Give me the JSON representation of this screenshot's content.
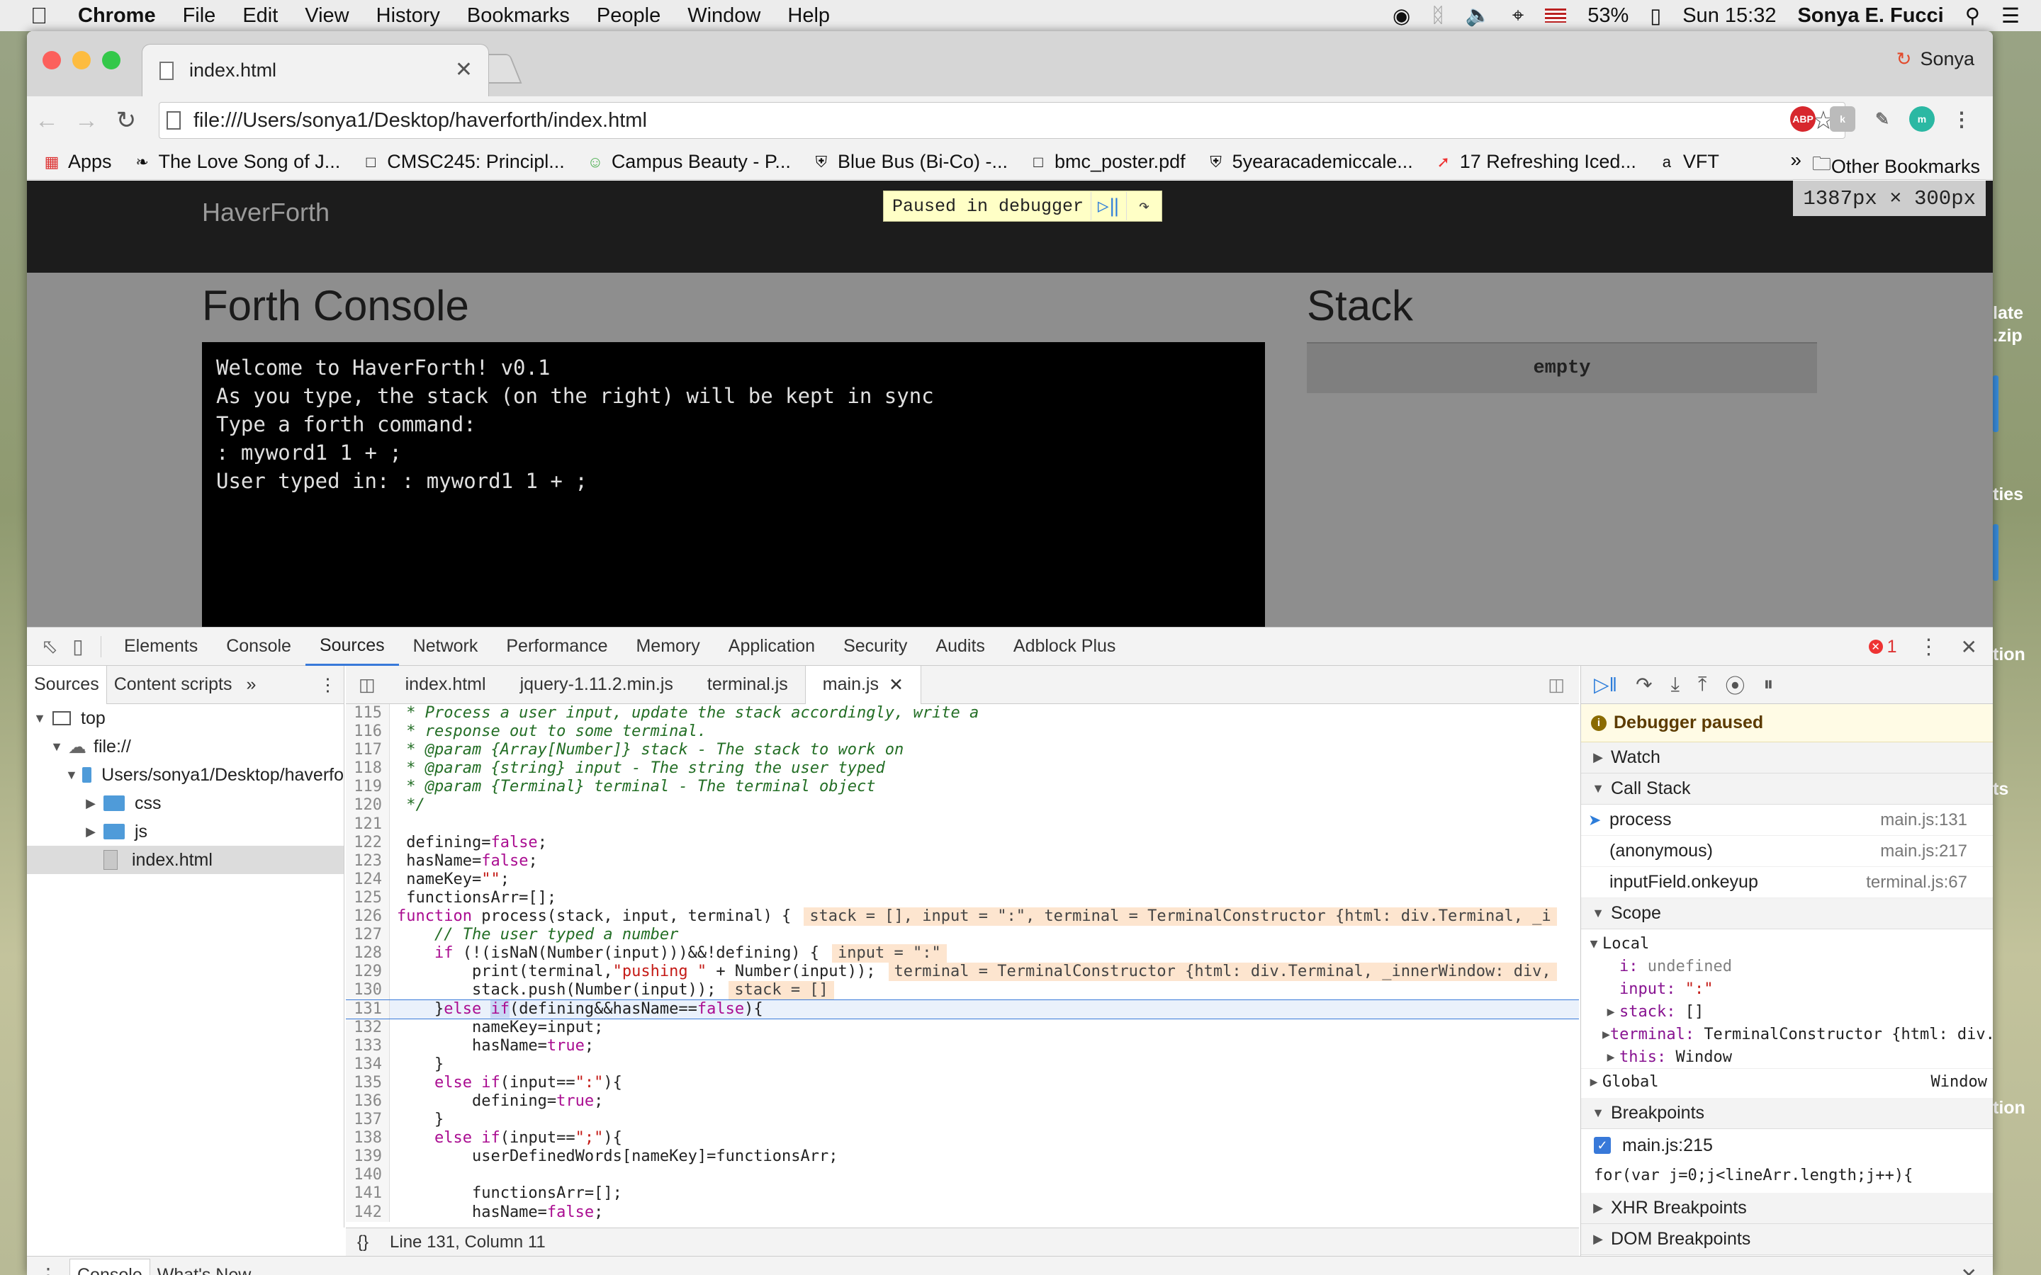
{
  "menubar": {
    "app": "Chrome",
    "items": [
      "File",
      "Edit",
      "View",
      "History",
      "Bookmarks",
      "People",
      "Window",
      "Help"
    ],
    "battery": "53%",
    "clock": "Sun 15:32",
    "user": "Sonya E. Fucci"
  },
  "browser": {
    "tab_title": "index.html",
    "profile_name": "Sonya",
    "url": "file:///Users/sonya1/Desktop/haverforth/index.html",
    "bookmarks": [
      "Apps",
      "The Love Song of J...",
      "CMSC245: Principl...",
      "Campus Beauty - P...",
      "Blue Bus (Bi-Co) -...",
      "bmc_poster.pdf",
      "5yearacademiccale...",
      "17 Refreshing Iced...",
      "VFT"
    ],
    "other_bookmarks": "Other Bookmarks"
  },
  "page": {
    "brand": "HaverForth",
    "paused_label": "Paused in debugger",
    "viewport_dims": "1387px × 300px",
    "console_title": "Forth Console",
    "stack_title": "Stack",
    "terminal_lines": [
      "Welcome to HaverForth! v0.1",
      "As you type, the stack (on the right) will be kept in sync",
      "Type a forth command:",
      ": myword1 1 + ;",
      "User typed in: : myword1 1 + ;"
    ],
    "stack_value": "empty"
  },
  "devtools": {
    "tabs": [
      "Elements",
      "Console",
      "Sources",
      "Network",
      "Performance",
      "Memory",
      "Application",
      "Security",
      "Audits",
      "Adblock Plus"
    ],
    "active_tab": "Sources",
    "error_count": "1",
    "navigator_tabs": [
      "Sources",
      "Content scripts"
    ],
    "tree": {
      "top": "top",
      "origin": "file://",
      "folder": "Users/sonya1/Desktop/haverfo",
      "css": "css",
      "js": "js",
      "file": "index.html"
    },
    "editor_tabs": [
      "index.html",
      "jquery-1.11.2.min.js",
      "terminal.js",
      "main.js"
    ],
    "status": "Line 131, Column 11",
    "debugger_paused": "Debugger paused",
    "sections": {
      "watch": "Watch",
      "call_stack": "Call Stack",
      "scope": "Scope",
      "breakpoints": "Breakpoints",
      "xhr": "XHR Breakpoints",
      "dom": "DOM Breakpoints"
    },
    "call_stack": [
      {
        "fn": "process",
        "loc": "main.js:131"
      },
      {
        "fn": "(anonymous)",
        "loc": "main.js:217"
      },
      {
        "fn": "inputField.onkeyup",
        "loc": "terminal.js:67"
      }
    ],
    "scope": {
      "local_label": "Local",
      "i_key": "i:",
      "i_val": "undefined",
      "input_key": "input:",
      "input_val": "\":\"",
      "stack_key": "stack:",
      "stack_val": "[]",
      "terminal_key": "terminal:",
      "terminal_val": "TerminalConstructor {html: div.Te",
      "this_key": "this:",
      "this_val": "Window",
      "global_label": "Global",
      "global_val": "Window"
    },
    "breakpoint_file": "main.js:215",
    "breakpoint_code": "for(var j=0;j<lineArr.length;j++){",
    "drawer_tabs": [
      "Console",
      "What's New"
    ]
  },
  "background_fragments": [
    "late",
    ".zip",
    "ties",
    "tion",
    "ts",
    "tion"
  ]
}
